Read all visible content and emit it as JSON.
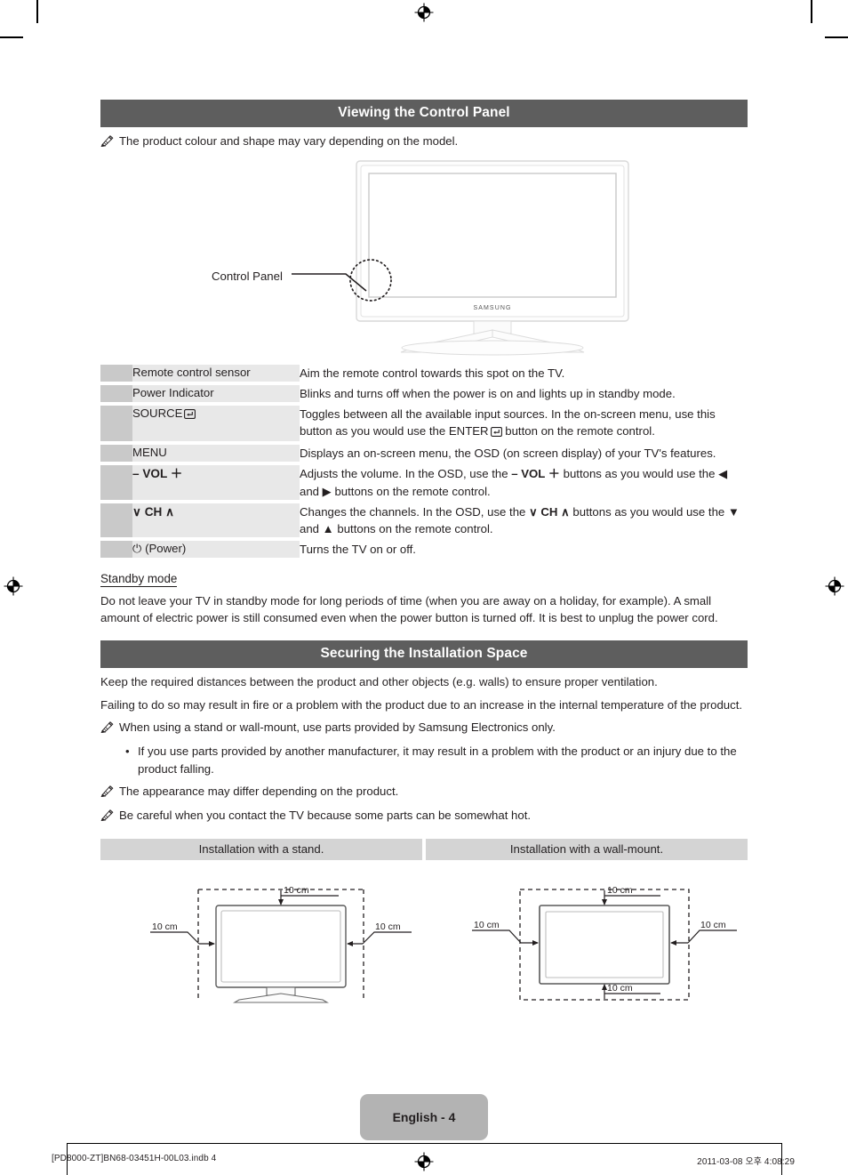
{
  "sections": {
    "control_panel": {
      "heading": "Viewing the Control Panel",
      "note": "The product colour and shape may vary depending on the model.",
      "callout_label": "Control Panel",
      "tv_brand": "SAMSUNG"
    },
    "installation": {
      "heading": "Securing the Installation Space",
      "para1": "Keep the required distances between the product and other objects (e.g. walls) to ensure proper ventilation.",
      "para2": "Failing to do so may result in fire or a problem with the product due to an increase in the internal temperature of the product.",
      "note1": "When using a stand or wall-mount, use parts provided by Samsung Electronics only.",
      "bullet1": "If you use parts provided by another manufacturer, it may result in a problem with the product or an injury due to the product falling.",
      "note2": "The appearance may differ depending on the product.",
      "note3": "Be careful when you contact the TV because some parts can be somewhat hot."
    },
    "standby": {
      "title": "Standby mode",
      "body": "Do not leave your TV in standby mode for long periods of time (when you are away on a holiday, for example). A small amount of electric power is still consumed even when the power button is turned off. It is best to unplug the power cord."
    }
  },
  "control_panel_table": [
    {
      "label": "Remote control sensor",
      "bold": false,
      "enter_glyph": false,
      "desc": "Aim the remote control towards this spot on the TV."
    },
    {
      "label": "Power Indicator",
      "bold": false,
      "enter_glyph": false,
      "desc": "Blinks and turns off when the power is on and lights up in standby mode."
    },
    {
      "label": "SOURCE",
      "bold": false,
      "enter_glyph": true,
      "desc_pre": "Toggles between all the available input sources. In the on-screen menu, use this button as you would use the ",
      "desc_mid": "ENTER",
      "desc_post": " button on the remote control."
    },
    {
      "label": "MENU",
      "bold": false,
      "enter_glyph": false,
      "desc": "Displays an on-screen menu, the OSD (on screen display) of your TV's features."
    },
    {
      "label": "– VOL ＋",
      "bold": true,
      "enter_glyph": false,
      "desc_pre": "Adjusts the volume. In the OSD, use the ",
      "desc_sym": "– VOL ＋",
      "desc_post": " buttons as you would use the ◀ and ▶ buttons on the remote control."
    },
    {
      "label": "∨ CH ∧",
      "bold": true,
      "enter_glyph": false,
      "desc_pre": "Changes the channels. In the OSD, use the ",
      "desc_sym": "∨ CH ∧",
      "desc_post": " buttons as you would use the ▼ and ▲ buttons on the remote control."
    },
    {
      "label": "⏻ (Power)",
      "bold": false,
      "enter_glyph": false,
      "desc": "Turns the TV on or off."
    }
  ],
  "install_diagrams": [
    {
      "title": "Installation with a stand.",
      "type": "stand",
      "labels": {
        "top": "10 cm",
        "left": "10 cm",
        "right": "10 cm"
      }
    },
    {
      "title": "Installation with a wall-mount.",
      "type": "wall-mount",
      "labels": {
        "top": "10 cm",
        "left": "10 cm",
        "right": "10 cm",
        "bottom": "10 cm"
      }
    }
  ],
  "footer": {
    "page_tab": "English - 4",
    "file_ref": "[PD8000-ZT]BN68-03451H-00L03.indb   4",
    "timestamp": "2011-03-08   오후 4:08:29"
  },
  "colors": {
    "section_bar": "#5e5e5e",
    "table_swatch": "#c9c9c9",
    "table_label": "#e8e8e8",
    "install_header": "#d4d4d4",
    "page_tab": "#b3b3b3"
  }
}
